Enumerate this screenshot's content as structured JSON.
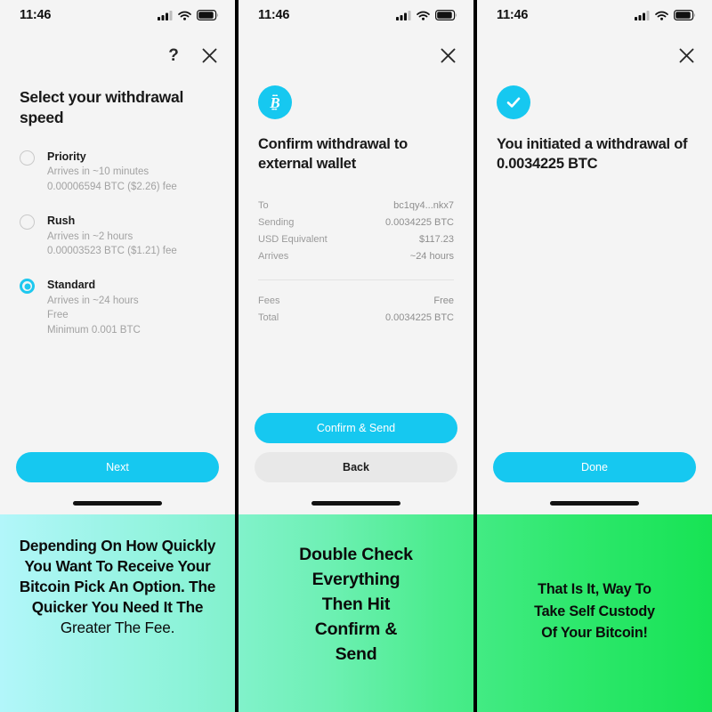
{
  "status_bar": {
    "time": "11:46",
    "icons": [
      "cellular-signal-icon",
      "wifi-icon",
      "battery-icon"
    ]
  },
  "colors": {
    "accent_cyan": "#16c8f0",
    "radio_cyan": "#1ec8ef",
    "screen_bg": "#f4f4f4",
    "secondary_button": "#e8e8e8",
    "gradient_start": "#b2f6fa",
    "gradient_end": "#17e354",
    "panel_divider": "#000000"
  },
  "panels": [
    {
      "id": "withdrawal-speed",
      "nav": {
        "help_label": "?",
        "help_icon": "question-mark-icon",
        "close_icon": "close-icon"
      },
      "headline": "Select your withdrawal speed",
      "options": [
        {
          "title": "Priority",
          "selected": false,
          "lines": [
            "Arrives in ~10 minutes",
            "0.00006594 BTC ($2.26) fee"
          ]
        },
        {
          "title": "Rush",
          "selected": false,
          "lines": [
            "Arrives in ~2 hours",
            "0.00003523 BTC ($1.21) fee"
          ]
        },
        {
          "title": "Standard",
          "selected": true,
          "lines": [
            "Arrives in ~24 hours",
            "Free",
            "Minimum 0.001 BTC"
          ]
        }
      ],
      "buttons": [
        {
          "label": "Next",
          "style": "primary",
          "name": "next-button"
        }
      ],
      "caption": {
        "style": "cap-a",
        "lines": [
          {
            "text": "Depending On How Quickly",
            "light": false
          },
          {
            "text": "You Want To Receive Your",
            "light": false
          },
          {
            "text": "Bitcoin Pick An Option. The",
            "light": false
          },
          {
            "text": "Quicker You Need It The",
            "light": false
          },
          {
            "text": "Greater The Fee.",
            "light": true
          }
        ]
      }
    },
    {
      "id": "confirm-withdrawal",
      "nav": {
        "close_icon": "close-icon"
      },
      "badge_icon": "bitcoin-icon",
      "headline": "Confirm withdrawal to external wallet",
      "details_top": [
        {
          "label": "To",
          "value": "bc1qy4...nkx7"
        },
        {
          "label": "Sending",
          "value": "0.0034225 BTC"
        },
        {
          "label": "USD Equivalent",
          "value": "$117.23"
        },
        {
          "label": "Arrives",
          "value": "~24 hours"
        }
      ],
      "details_bottom": [
        {
          "label": "Fees",
          "value": "Free"
        },
        {
          "label": "Total",
          "value": "0.0034225 BTC"
        }
      ],
      "buttons": [
        {
          "label": "Confirm & Send",
          "style": "primary",
          "name": "confirm-and-send-button"
        },
        {
          "label": "Back",
          "style": "secondary",
          "name": "back-button"
        }
      ],
      "caption": {
        "style": "cap-b",
        "lines": [
          {
            "text": "Double Check",
            "light": false
          },
          {
            "text": "Everything",
            "light": false
          },
          {
            "text": "Then Hit",
            "light": false
          },
          {
            "text": "Confirm &",
            "light": false
          },
          {
            "text": "Send",
            "light": false
          }
        ]
      }
    },
    {
      "id": "withdrawal-initiated",
      "nav": {
        "close_icon": "close-icon"
      },
      "badge_icon": "check-circle-icon",
      "headline": "You initiated a withdrawal of 0.0034225 BTC",
      "buttons": [
        {
          "label": "Done",
          "style": "primary",
          "name": "done-button"
        }
      ],
      "caption": {
        "style": "cap-c",
        "lines": [
          {
            "text": "That Is It, Way To",
            "light": false
          },
          {
            "text": "Take Self Custody",
            "light": false
          },
          {
            "text": "Of Your Bitcoin!",
            "light": false
          }
        ]
      }
    }
  ]
}
